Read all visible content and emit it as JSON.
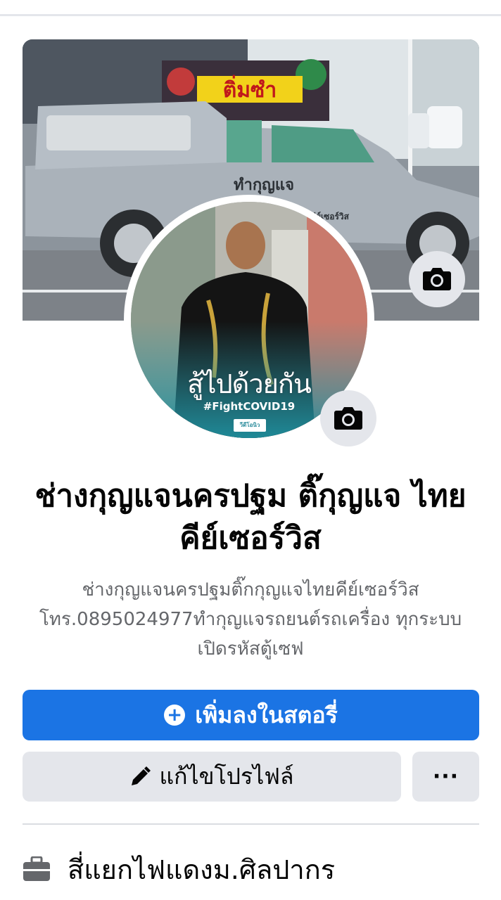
{
  "cover": {
    "banner_text": "ติ่มซำ",
    "truck_door_text": "ทำกุญแจ",
    "truck_side_text": "ไทยคีย์เซอร์วิส"
  },
  "avatar": {
    "frame_title": "สู้ไปด้วยกัน",
    "frame_tag": "#FightCOVID19",
    "frame_logo": "วีดีโอนิว"
  },
  "profile": {
    "name": "ช่างกุญแจนครปฐม ติ๊กุญแจ ไทยคีย์เซอร์วิส",
    "bio": "ช่างกุญแจนครปฐมติ๊กกุญแจไทยคีย์เซอร์วิส โทร.0895024977ทำกุญแจรถยนต์รถเครื่อง ทุกระบบ เปิดรหัสตู้เซฟ"
  },
  "actions": {
    "add_story_label": "เพิ่มลงในสตอรี่",
    "edit_profile_label": "แก้ไขโปรไฟล์",
    "more_label": "···"
  },
  "info": {
    "location_text": "สี่แยกไฟแดงม.ศิลปากร"
  },
  "icons": {
    "camera": "camera-icon",
    "plus": "plus-circle-icon",
    "pencil": "pencil-icon",
    "briefcase": "briefcase-icon"
  },
  "colors": {
    "primary": "#1b74e4",
    "secondary_button": "#e4e6eb",
    "muted_text": "#65676b"
  }
}
